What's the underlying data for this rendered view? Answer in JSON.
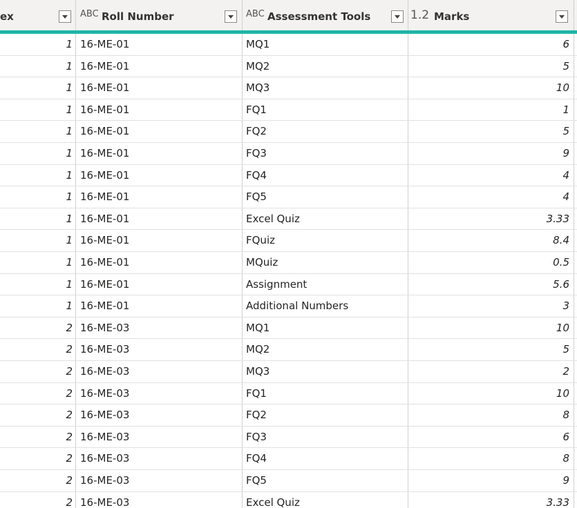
{
  "columns": {
    "index": {
      "label": "ex"
    },
    "roll": {
      "type_icon": "ABC",
      "label": "Roll Number"
    },
    "tool": {
      "type_icon": "ABC",
      "label": "Assessment Tools"
    },
    "marks": {
      "type_icon": "1.2",
      "label": "Marks"
    }
  },
  "rows": [
    {
      "index": "1",
      "roll": "16-ME-01",
      "tool": "MQ1",
      "marks": "6"
    },
    {
      "index": "1",
      "roll": "16-ME-01",
      "tool": "MQ2",
      "marks": "5"
    },
    {
      "index": "1",
      "roll": "16-ME-01",
      "tool": "MQ3",
      "marks": "10"
    },
    {
      "index": "1",
      "roll": "16-ME-01",
      "tool": "FQ1",
      "marks": "1"
    },
    {
      "index": "1",
      "roll": "16-ME-01",
      "tool": "FQ2",
      "marks": "5"
    },
    {
      "index": "1",
      "roll": "16-ME-01",
      "tool": "FQ3",
      "marks": "9"
    },
    {
      "index": "1",
      "roll": "16-ME-01",
      "tool": "FQ4",
      "marks": "4"
    },
    {
      "index": "1",
      "roll": "16-ME-01",
      "tool": "FQ5",
      "marks": "4"
    },
    {
      "index": "1",
      "roll": "16-ME-01",
      "tool": "Excel Quiz",
      "marks": "3.33"
    },
    {
      "index": "1",
      "roll": "16-ME-01",
      "tool": "FQuiz",
      "marks": "8.4"
    },
    {
      "index": "1",
      "roll": "16-ME-01",
      "tool": "MQuiz",
      "marks": "0.5"
    },
    {
      "index": "1",
      "roll": "16-ME-01",
      "tool": "Assignment",
      "marks": "5.6"
    },
    {
      "index": "1",
      "roll": "16-ME-01",
      "tool": "Additional Numbers",
      "marks": "3"
    },
    {
      "index": "2",
      "roll": "16-ME-03",
      "tool": "MQ1",
      "marks": "10"
    },
    {
      "index": "2",
      "roll": "16-ME-03",
      "tool": "MQ2",
      "marks": "5"
    },
    {
      "index": "2",
      "roll": "16-ME-03",
      "tool": "MQ3",
      "marks": "2"
    },
    {
      "index": "2",
      "roll": "16-ME-03",
      "tool": "FQ1",
      "marks": "10"
    },
    {
      "index": "2",
      "roll": "16-ME-03",
      "tool": "FQ2",
      "marks": "8"
    },
    {
      "index": "2",
      "roll": "16-ME-03",
      "tool": "FQ3",
      "marks": "6"
    },
    {
      "index": "2",
      "roll": "16-ME-03",
      "tool": "FQ4",
      "marks": "8"
    },
    {
      "index": "2",
      "roll": "16-ME-03",
      "tool": "FQ5",
      "marks": "9"
    },
    {
      "index": "2",
      "roll": "16-ME-03",
      "tool": "Excel Quiz",
      "marks": "3.33"
    }
  ],
  "colors": {
    "header_accent": "#1fb5a6",
    "header_bg": "#f3f2f1",
    "grid_line": "#e1e1e1"
  },
  "icons": {
    "text_type": "abc-type-icon",
    "number_type": "decimal-type-icon",
    "filter_dropdown": "chevron-down-icon"
  }
}
